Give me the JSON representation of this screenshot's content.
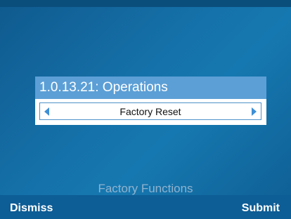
{
  "screen": {
    "background_title": "Factory Functions"
  },
  "dialog": {
    "title": "1.0.13.21: Operations",
    "selected_option": "Factory Reset",
    "left_icon": "triangle-left-icon",
    "right_icon": "triangle-right-icon"
  },
  "softkeys": {
    "left_label": "Dismiss",
    "right_label": "Submit"
  },
  "colors": {
    "background": "#1570a8",
    "dialog_header": "#5c9fd6",
    "softkey_bar": "#0d5d96",
    "arrow": "#3d8fd6"
  }
}
